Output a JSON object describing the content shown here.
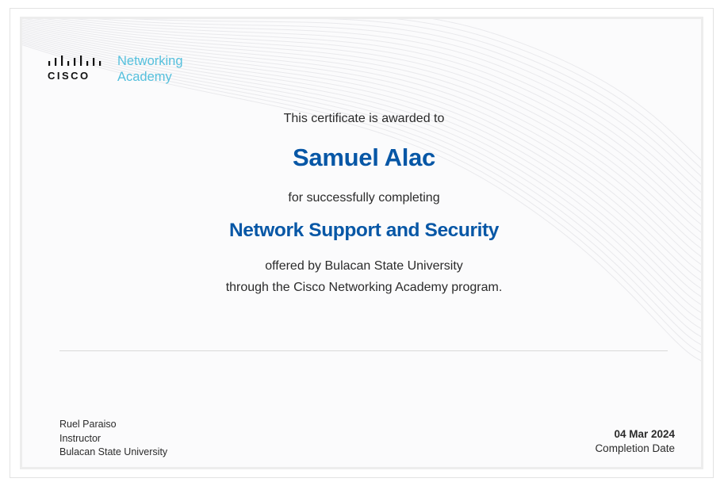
{
  "logo": {
    "brand": "CISCO",
    "word1": "Networking",
    "word2": "Academy",
    "icon": "cisco-bridge-bars-icon",
    "accent_color": "#55c0dd"
  },
  "certificate": {
    "intro": "This certificate is awarded to",
    "recipient": "Samuel Alac",
    "completing": "for successfully completing",
    "course": "Network Support and Security",
    "offered_line1": "offered by Bulacan State University",
    "offered_line2": "through the Cisco Networking Academy program.",
    "highlight_color": "#0757a6"
  },
  "signer": {
    "name": "Ruel Paraiso",
    "role": "Instructor",
    "institution": "Bulacan State University"
  },
  "completion": {
    "date": "04 Mar 2024",
    "label": "Completion Date"
  }
}
